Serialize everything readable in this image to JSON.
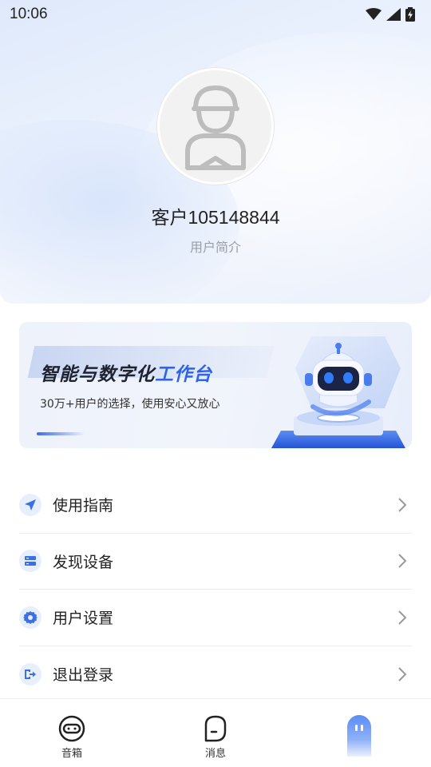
{
  "status_bar": {
    "time": "10:06",
    "icons": [
      "wifi-icon",
      "cellular-signal-icon",
      "battery-charging-icon"
    ]
  },
  "profile": {
    "avatar_icon": "default-user-avatar-icon",
    "name": "客户105148844",
    "bio": "用户简介"
  },
  "banner": {
    "title_main": "智能与数字化",
    "title_highlight": "工作台",
    "subtitle": "30万+用户的选择，使用安心又放心",
    "illustration": "robot-illustration"
  },
  "menu": {
    "items": [
      {
        "label": "使用指南",
        "icon": "navigation-arrow-icon"
      },
      {
        "label": "发现设备",
        "icon": "device-list-icon"
      },
      {
        "label": "用户设置",
        "icon": "settings-gear-icon"
      },
      {
        "label": "退出登录",
        "icon": "logout-icon"
      }
    ]
  },
  "bottom_nav": {
    "tabs": [
      {
        "label": "音箱",
        "icon": "speaker-icon"
      },
      {
        "label": "消息",
        "icon": "message-icon"
      },
      {
        "label": "",
        "icon": "profile-active-icon",
        "active": true
      }
    ]
  },
  "colors": {
    "accent": "#2e63e8",
    "menu_icon": "#3a6fe6",
    "menu_icon_bg": "#e8effc"
  }
}
